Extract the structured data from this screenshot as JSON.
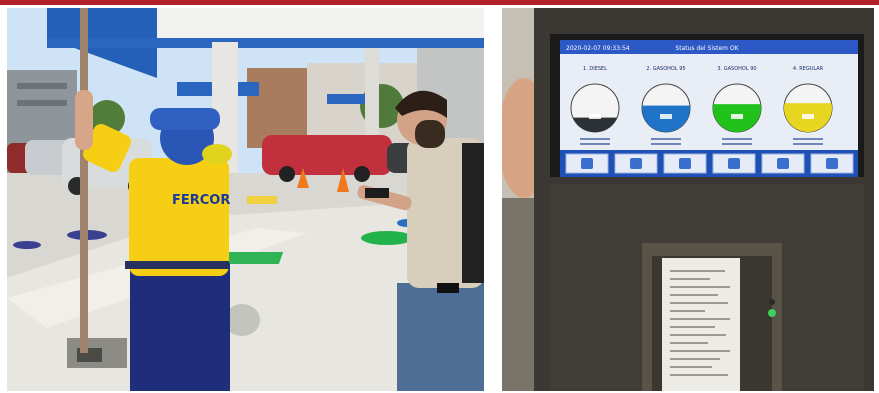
{
  "shirt_logo": "FERCOR",
  "monitor": {
    "timestamp": "2020-02-07 09:33:54",
    "title": "Status del Sistem OK",
    "tanks": [
      {
        "name": "1. DIESEL",
        "level": 0.3,
        "color": "#2c3135"
      },
      {
        "name": "2. GASOHOL 95",
        "level": 0.55,
        "color": "#1f74c9"
      },
      {
        "name": "3. GASOHOL 90",
        "level": 0.58,
        "color": "#22c21d"
      },
      {
        "name": "4. REGULAR",
        "level": 0.6,
        "color": "#e7d61f"
      }
    ],
    "function_buttons": [
      "report-icon",
      "tank-icon",
      "delivery-icon",
      "leak-icon",
      "printer-icon",
      "setup-icon"
    ]
  }
}
